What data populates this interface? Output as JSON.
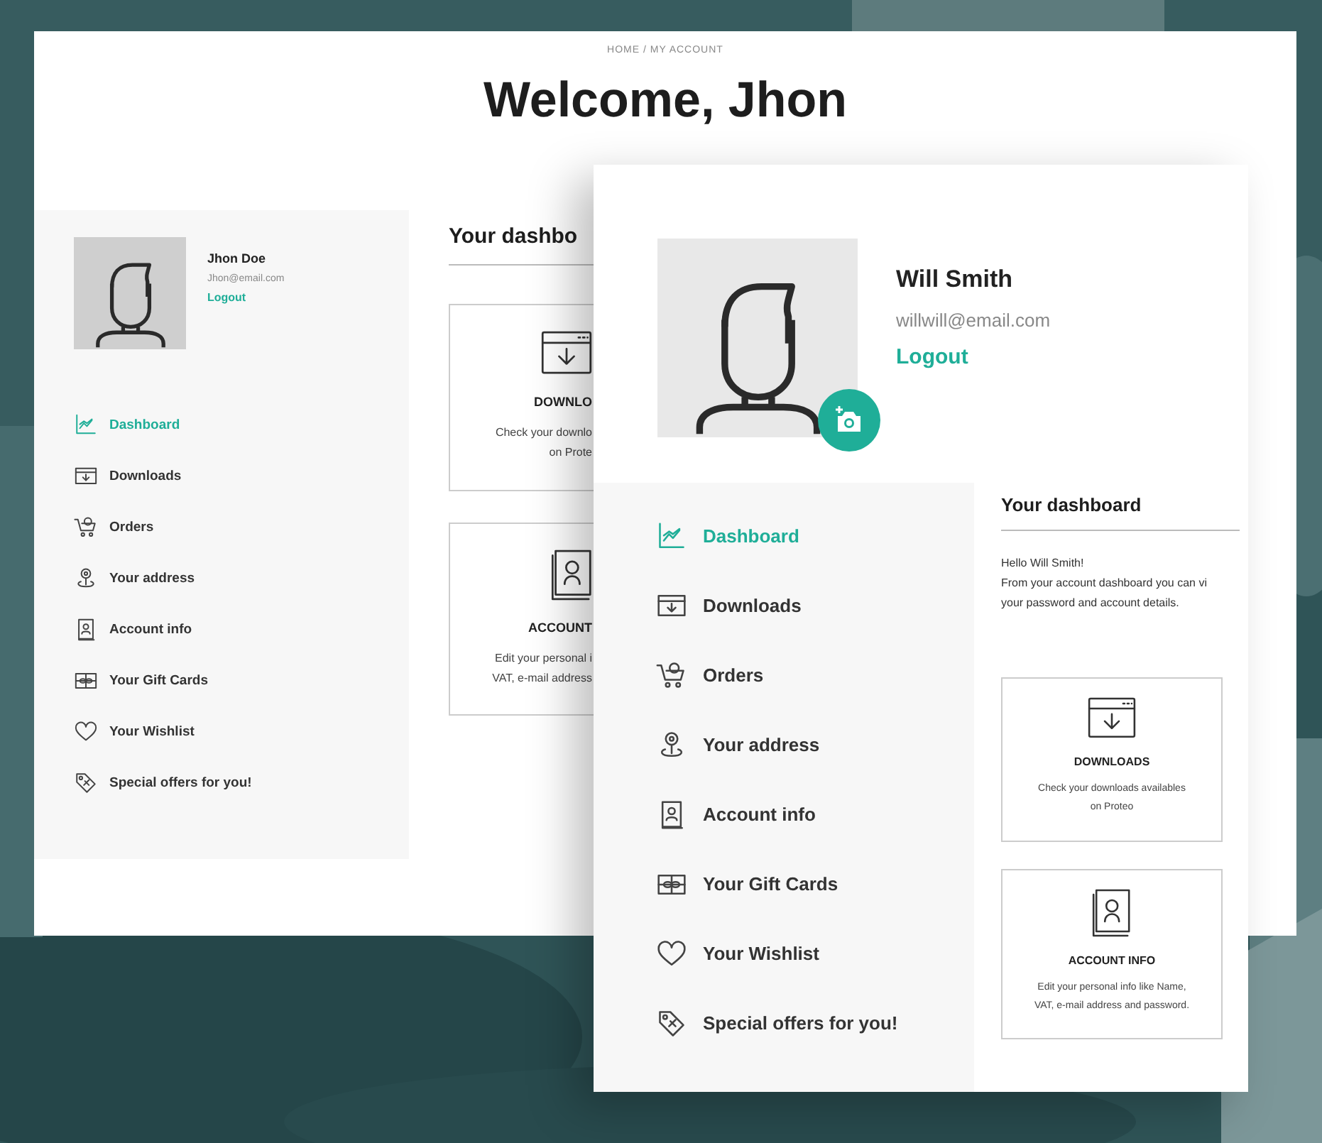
{
  "back_screen": {
    "breadcrumb": "HOME / MY ACCOUNT",
    "title": "Welcome, Jhon",
    "profile": {
      "name": "Jhon Doe",
      "email": "Jhon@email.com",
      "logout": "Logout"
    },
    "menu": [
      {
        "kind": "dashboard",
        "label": "Dashboard",
        "selected": true
      },
      {
        "kind": "downloads",
        "label": "Downloads",
        "selected": false
      },
      {
        "kind": "orders",
        "label": "Orders",
        "selected": false
      },
      {
        "kind": "address",
        "label": "Your address",
        "selected": false
      },
      {
        "kind": "account",
        "label": "Account info",
        "selected": false
      },
      {
        "kind": "gift",
        "label": "Your Gift Cards",
        "selected": false
      },
      {
        "kind": "wishlist",
        "label": "Your Wishlist",
        "selected": false
      },
      {
        "kind": "offers",
        "label": "Special offers for you!",
        "selected": false
      }
    ],
    "dashboard_title": "Your dashbo",
    "cards": [
      {
        "kind": "downloads",
        "title": "DOWNLO",
        "lines": [
          "Check your downlo",
          "on Prote"
        ]
      },
      {
        "kind": "account",
        "title": "ACCOUNT",
        "lines": [
          "Edit your personal i",
          "VAT,  e-mail address"
        ]
      }
    ]
  },
  "front_screen": {
    "profile": {
      "name": "Will Smith",
      "email": "willwill@email.com",
      "logout": "Logout"
    },
    "menu": [
      {
        "kind": "dashboard",
        "label": "Dashboard",
        "selected": true
      },
      {
        "kind": "downloads",
        "label": "Downloads",
        "selected": false
      },
      {
        "kind": "orders",
        "label": "Orders",
        "selected": false
      },
      {
        "kind": "address",
        "label": "Your address",
        "selected": false
      },
      {
        "kind": "account",
        "label": "Account info",
        "selected": false
      },
      {
        "kind": "gift",
        "label": "Your Gift Cards",
        "selected": false
      },
      {
        "kind": "wishlist",
        "label": "Your Wishlist",
        "selected": false
      },
      {
        "kind": "offers",
        "label": "Special offers for you!",
        "selected": false
      }
    ],
    "dashboard_title": "Your dashboard",
    "greeting": [
      "Hello Will Smith!",
      "From your account dashboard you can vi",
      "your password and account details."
    ],
    "cards": [
      {
        "kind": "downloads",
        "title": "DOWNLOADS",
        "lines": [
          "Check your downloads availables",
          "on Proteo"
        ]
      },
      {
        "kind": "account",
        "title": "ACCOUNT INFO",
        "lines": [
          "Edit your personal info like Name,",
          "VAT,  e-mail address and password."
        ]
      }
    ]
  }
}
